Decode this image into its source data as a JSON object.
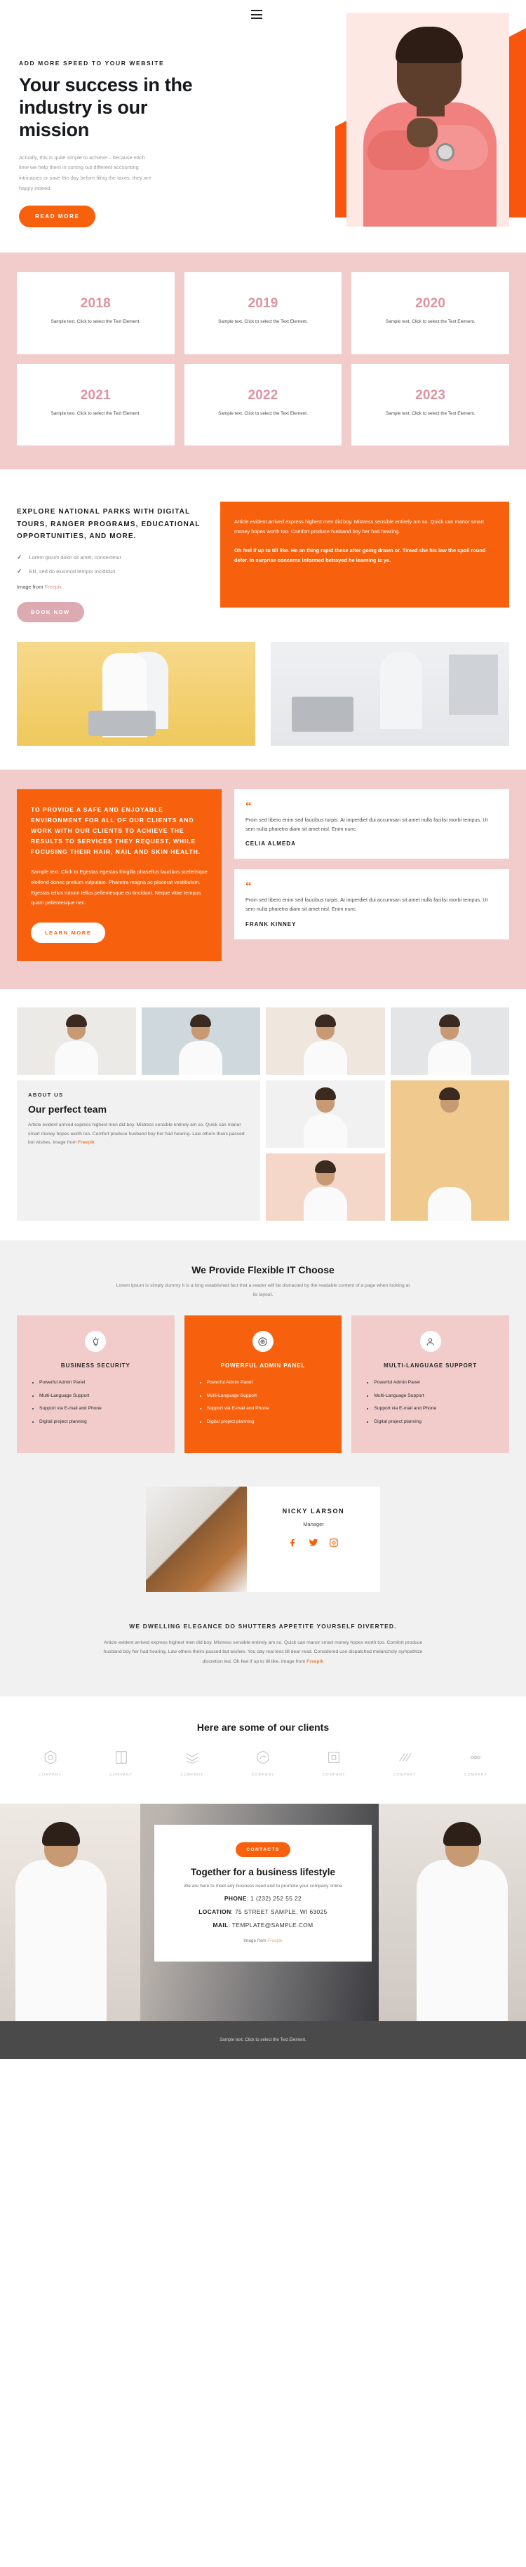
{
  "hero": {
    "menu_icon": "hamburger-menu-icon",
    "eyebrow": "ADD MORE SPEED TO YOUR WEBSITE",
    "title": "Your success in the industry is our mission",
    "paragraph": "Actually, this is quite simple to achieve – because each time we help them in sorting out different accounting intricacies or save the day before filing the taxes, they are happy indeed.",
    "cta_label": "READ MORE"
  },
  "years": {
    "cards": [
      {
        "year": "2018",
        "text": "Sample text. Click to select the Text Element."
      },
      {
        "year": "2019",
        "text": "Sample text. Click to select the Text Element."
      },
      {
        "year": "2020",
        "text": "Sample text. Click to select the Text Element."
      },
      {
        "year": "2021",
        "text": "Sample text. Click to select the Text Element."
      },
      {
        "year": "2022",
        "text": "Sample text. Click to select the Text Element."
      },
      {
        "year": "2023",
        "text": "Sample text. Click to select the Text Element."
      }
    ]
  },
  "parks": {
    "heading": "EXPLORE NATIONAL PARKS WITH DIGITAL TOURS, RANGER PROGRAMS, EDUCATIONAL OPPORTUNITIES, AND MORE.",
    "checks": [
      "Lorem ipsum dolor sit amet, consectetur",
      "Elit, sed do eiusmod tempor incididun"
    ],
    "image_from_prefix": "Image from ",
    "image_from_link": "Freepik",
    "cta_label": "BOOK NOW",
    "panel_p1": "Article evident arrived express highest men did boy. Mistress sensible entirely am so. Quick can manor smart money hopes worth too. Comfort produce husband boy her had hearing.",
    "panel_p2": "Oh feel if up to till like. He an thing rapid these after going drawn or. Timed she his law the spoil round defer. In surprise concerns informed betrayed he learning is ye."
  },
  "mission": {
    "heading": "TO PROVIDE A SAFE AND ENJOYABLE ENVIRONMENT FOR ALL OF OUR CLIENTS AND WORK WITH OUR CLIENTS TO ACHIEVE THE RESULTS TO SERVICES THEY REQUEST, WHILE FOCUSING THEIR HAIR, NAIL AND SKIN HEALTH.",
    "body": "Sample text. Click to Egestas egestas fringilla phasellus faucibus scelerisque eleifend donec pretium vulputate. Pharetra magna ac placerat vestibulum. Egestas tellus rutrum tellus pellentesque eu tincidunt. Neque vitae tempus quam pellentesque nec.",
    "cta_label": "LEARN MORE",
    "quotes": [
      {
        "text": "Proin sed libero enim sed faucibus turpis. At imperdiet dui accumsan sit amet nulla facilisi morbi tempus. Ut sem nulla pharetra diam sit amet nisl. Enim nunc",
        "name": "CELIA ALMEDA"
      },
      {
        "text": "Proin sed libero enim sed faucibus turpis. At imperdiet dui accumsan sit amet nulla facilisi morbi tempus. Ut sem nulla pharetra diam sit amet nisl. Enim nunc",
        "name": "FRANK KINNEY"
      }
    ]
  },
  "about": {
    "eyebrow": "ABOUT US",
    "title": "Our perfect team",
    "text": "Article evident arrived express highest men did boy. Mistress sensible entirely am so. Quick can manor smart money hopes worth too. Comfort produce husband boy her had hearing. Law others theirs passed but wishes. Image from ",
    "link": "Freepik"
  },
  "flexible": {
    "title": "We Provide Flexible IT Choose",
    "subtitle": "Lorem Ipsum is simply dummy It is a long established fact that a reader will be distracted by the readable content of a page when looking at its layout.",
    "cards": [
      {
        "icon": "lightbulb-icon",
        "name": "BUSINESS SECURITY",
        "items": [
          "Powerful Admin Panel",
          "Multi-Language Support",
          "Support via E-mail and Phone",
          "Digital project planning"
        ]
      },
      {
        "icon": "target-icon",
        "name": "POWERFUL ADMIN PANEL",
        "items": [
          "Powerful Admin Panel",
          "Multi-Language Support",
          "Support via E-mail and Phone",
          "Digital project planning"
        ]
      },
      {
        "icon": "user-icon",
        "name": "MULTI-LANGUAGE SUPPORT",
        "items": [
          "Powerful Admin Panel",
          "Multi-Language Support",
          "Support via E-mail and Phone",
          "Digital project planning"
        ]
      }
    ]
  },
  "manager": {
    "name": "NICKY LARSON",
    "role": "Manager",
    "socials": [
      "facebook-icon",
      "twitter-icon",
      "instagram-icon"
    ]
  },
  "dwelling": {
    "heading": "WE DWELLING ELEGANCE DO SHUTTERS APPETITE YOURSELF DIVERTED.",
    "text": "Article evident arrived express highest men did boy. Mistress sensible entirely am so. Quick can manor smart money hopes worth too. Comfort produce husband boy her had hearing. Law others theirs passed but wishes. You day real less till dear read. Considered use dispatched melancholy sympathize discretion led. Oh feel if up to till like. Image from ",
    "link": "Freepik"
  },
  "clients": {
    "title": "Here are some of our clients",
    "items": [
      {
        "icon": "hexagon-icon",
        "label": "COMPANY"
      },
      {
        "icon": "book-icon",
        "label": "COMPANY"
      },
      {
        "icon": "wave-icon",
        "label": "COMPANY"
      },
      {
        "icon": "circle-swirl-icon",
        "label": "COMPANY"
      },
      {
        "icon": "frame-icon",
        "label": "COMPANY"
      },
      {
        "icon": "lines-icon",
        "label": "COMPANY"
      },
      {
        "icon": "dots-icon",
        "label": "COMPANY"
      }
    ]
  },
  "contact": {
    "badge": "CONTACTS",
    "title": "Together for a business lifestyle",
    "subtitle": "We are here to meet any business need and to promote your company online",
    "phone_label": "PHONE",
    "phone_value": ": 1 (232) 252 55 22",
    "location_label": "LOCATION",
    "location_value": ": 75 STREET SAMPLE, WI 63025",
    "mail_label": "MAIL",
    "mail_value": ": TEMPLATE@SAMPLE.COM",
    "image_from_prefix": "Image from ",
    "image_from_link": "Freepik"
  },
  "footer": {
    "text": "Sample text. Click to select the Text Element."
  }
}
